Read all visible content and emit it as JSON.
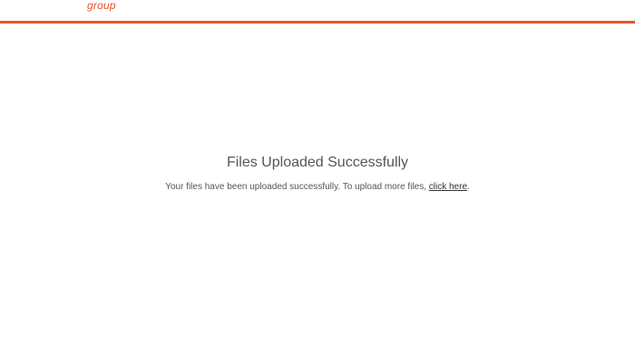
{
  "header": {
    "logo_text": "group",
    "brand_color": "#e8542a"
  },
  "main": {
    "title": "Files Uploaded Successfully",
    "message_prefix": "Your files have been uploaded successfully. To upload more files,",
    "link_label": "click here",
    "message_suffix": "."
  }
}
